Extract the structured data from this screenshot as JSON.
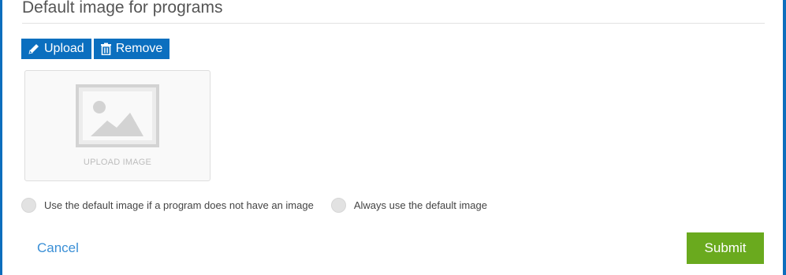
{
  "section": {
    "title": "Default image for programs"
  },
  "toolbar": {
    "upload_label": "Upload",
    "remove_label": "Remove",
    "icons": [
      "pencil-icon",
      "trash-icon"
    ]
  },
  "upload_box": {
    "caption": "UPLOAD IMAGE",
    "icon": "image-placeholder-icon"
  },
  "options": [
    {
      "label": "Use the default image if a program does not have an image",
      "selected": false
    },
    {
      "label": "Always use the default image",
      "selected": false
    }
  ],
  "footer": {
    "cancel_label": "Cancel",
    "submit_label": "Submit"
  },
  "colors": {
    "primary_blue": "#0b6fbf",
    "link_blue": "#3a8fd6",
    "submit_green": "#6aaa1e"
  }
}
